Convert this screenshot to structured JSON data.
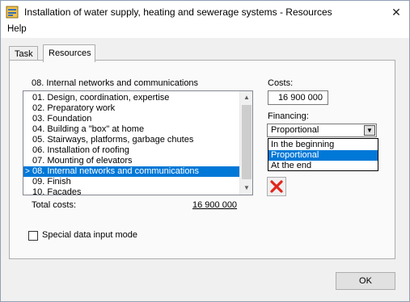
{
  "window": {
    "title": "Installation of water supply, heating and sewerage systems - Resources",
    "close_glyph": "✕"
  },
  "menu": {
    "help": "Help"
  },
  "tabs": [
    {
      "label": "Task",
      "active": false
    },
    {
      "label": "Resources",
      "active": true
    }
  ],
  "resources": {
    "current_section": "08. Internal networks and communications",
    "items": [
      {
        "label": "01. Design, coordination, expertise"
      },
      {
        "label": "02. Preparatory work"
      },
      {
        "label": "03. Foundation"
      },
      {
        "label": "04. Building a \"box\" at home"
      },
      {
        "label": "05. Stairways, platforms, garbage chutes"
      },
      {
        "label": "06. Installation of roofing"
      },
      {
        "label": "07. Mounting of elevators"
      },
      {
        "label": "08. Internal networks and communications",
        "selected": true,
        "marker": ">"
      },
      {
        "label": "09. Finish"
      },
      {
        "label": "10. Facades"
      }
    ],
    "total_label": "Total costs:",
    "total_value": "16 900 000",
    "special_mode_label": "Special data input mode",
    "special_mode_checked": false
  },
  "costs": {
    "label": "Costs:",
    "value": "16 900 000"
  },
  "financing": {
    "label": "Financing:",
    "selected": "Proportional",
    "options": [
      "In the beginning",
      "Proportional",
      "At the end"
    ],
    "highlighted_index": 1
  },
  "buttons": {
    "ok": "OK"
  },
  "colors": {
    "selection": "#0078d7",
    "delete_icon": "#e0261c"
  },
  "icons": {
    "app": "app-icon",
    "delete": "red-x-icon",
    "combo": "chevron-down-icon"
  }
}
